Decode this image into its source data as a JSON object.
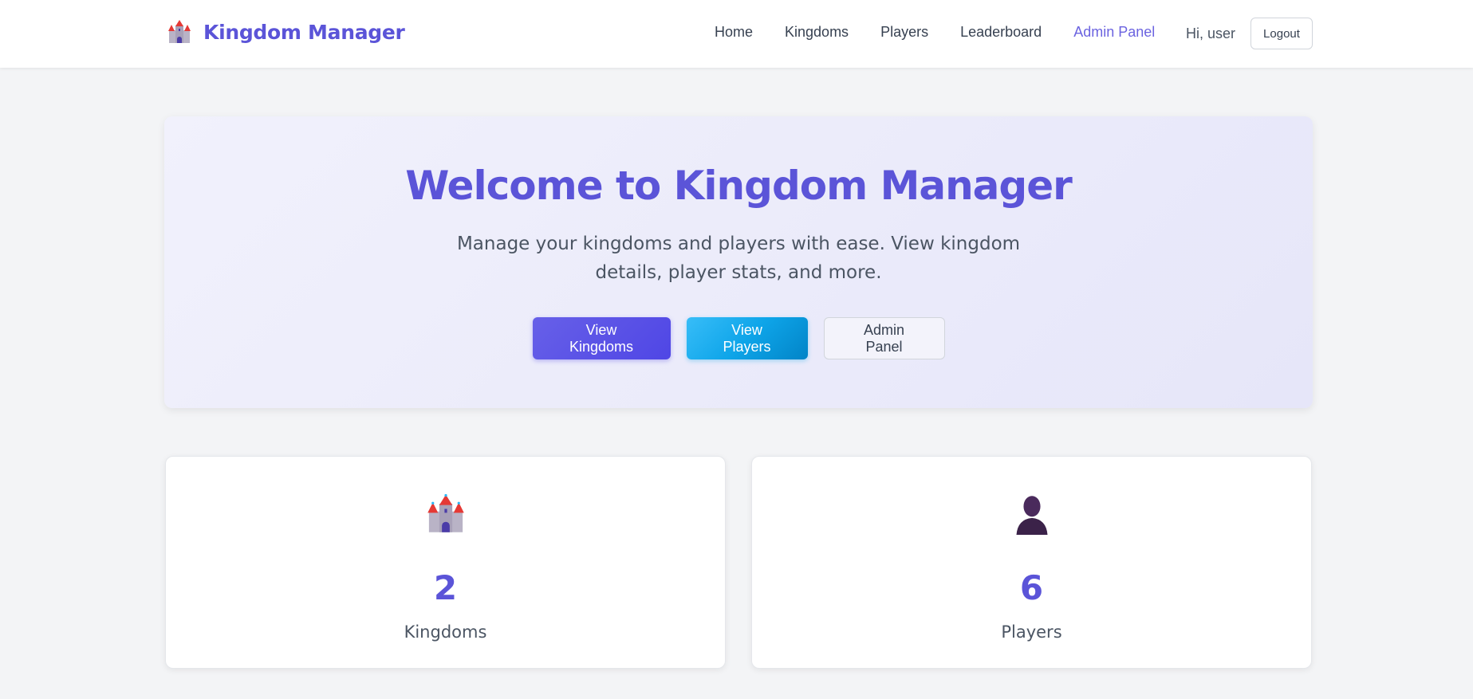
{
  "app": {
    "brand_name": "Kingdom Manager",
    "brand_icon": "castle-icon",
    "accent_color": "#5b54d8"
  },
  "nav": {
    "items": [
      {
        "label": "Home",
        "active": false
      },
      {
        "label": "Kingdoms",
        "active": false
      },
      {
        "label": "Players",
        "active": false
      },
      {
        "label": "Leaderboard",
        "active": false
      },
      {
        "label": "Admin Panel",
        "active": true
      }
    ],
    "greeting": "Hi, user",
    "logout_label": "Logout"
  },
  "hero": {
    "title": "Welcome to Kingdom Manager",
    "subtitle": "Manage your kingdoms and players with ease. View kingdom details, player stats, and more.",
    "buttons": {
      "view_kingdoms": "View Kingdoms",
      "view_players": "View Players",
      "admin_panel": "Admin Panel"
    }
  },
  "stats": [
    {
      "icon": "castle-icon",
      "value": "2",
      "label": "Kingdoms"
    },
    {
      "icon": "person-icon",
      "value": "6",
      "label": "Players"
    }
  ]
}
